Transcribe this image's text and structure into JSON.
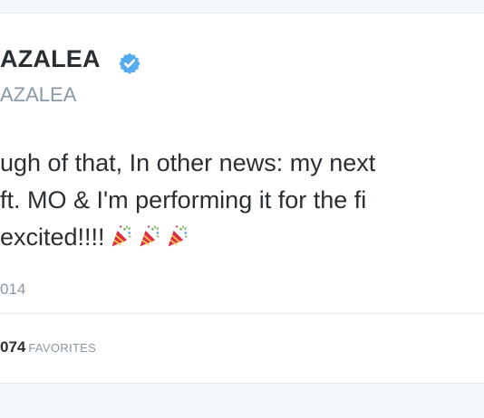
{
  "profile": {
    "display_name": "AZALEA",
    "handle": "AZALEA",
    "verified_icon": "verified-badge-icon"
  },
  "tweet": {
    "lines": [
      "ugh of that, In other news: my next",
      "ft. MO & I'm performing it for the fi",
      "excited!!!!"
    ],
    "emoji_icon": "party-popper-icon",
    "timestamp": "014"
  },
  "stats": {
    "favorites_count": "074",
    "favorites_label": "FAVORITES"
  },
  "colors": {
    "text": "#292f33",
    "muted": "#8899a6",
    "verified_blue": "#55acee",
    "border": "#e1e8ed"
  }
}
